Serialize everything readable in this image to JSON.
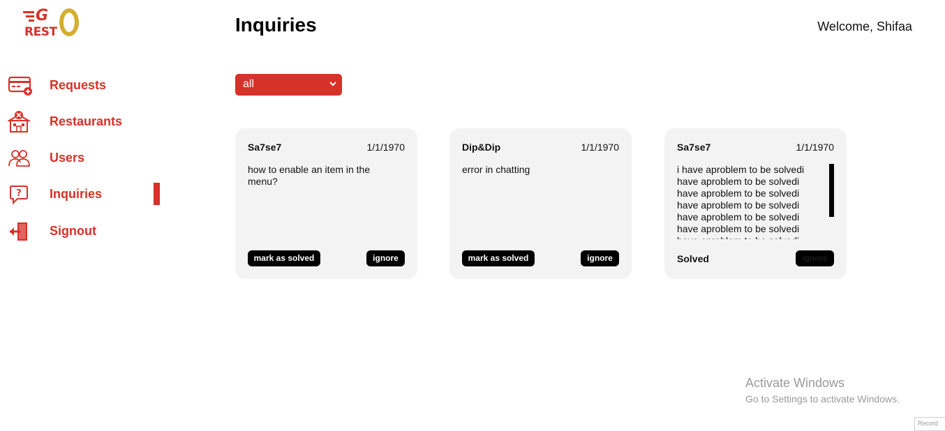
{
  "logo": {
    "top_text": "G",
    "bottom_text": "REST"
  },
  "header": {
    "title": "Inquiries",
    "welcome": "Welcome, Shifaa"
  },
  "sidebar": {
    "items": [
      {
        "label": "Requests",
        "icon": "credit-card-add-icon"
      },
      {
        "label": "Restaurants",
        "icon": "restaurant-building-icon"
      },
      {
        "label": "Users",
        "icon": "users-icon"
      },
      {
        "label": "Inquiries",
        "icon": "question-bubble-icon",
        "active": true
      },
      {
        "label": "Signout",
        "icon": "signout-door-icon"
      }
    ]
  },
  "filter": {
    "value": "all"
  },
  "cards": [
    {
      "name": "Sa7se7",
      "date": "1/1/1970",
      "message": "how to enable an item in the menu?",
      "solved_label": "mark as solved",
      "ignore_label": "ignore"
    },
    {
      "name": "Dip&Dip",
      "date": "1/1/1970",
      "message": "error in chatting",
      "solved_label": "mark as solved",
      "ignore_label": "ignore"
    },
    {
      "name": "Sa7se7",
      "date": "1/1/1970",
      "message": "i have aproblem to be solvedi have aproblem to be solvedi have aproblem to be solvedi have aproblem to be solvedi have aproblem to be solvedi have aproblem to be solvedi have aproblem to be solvedi",
      "status": "Solved",
      "ignore_label": "ignore"
    }
  ],
  "watermark": {
    "title": "Activate Windows",
    "subtitle": "Go to Settings to activate Windows."
  },
  "corner": {
    "text": "Record"
  },
  "colors": {
    "accent": "#d63229",
    "logo_gold": "#d4ae2e",
    "card_bg": "#f3f3f3"
  }
}
